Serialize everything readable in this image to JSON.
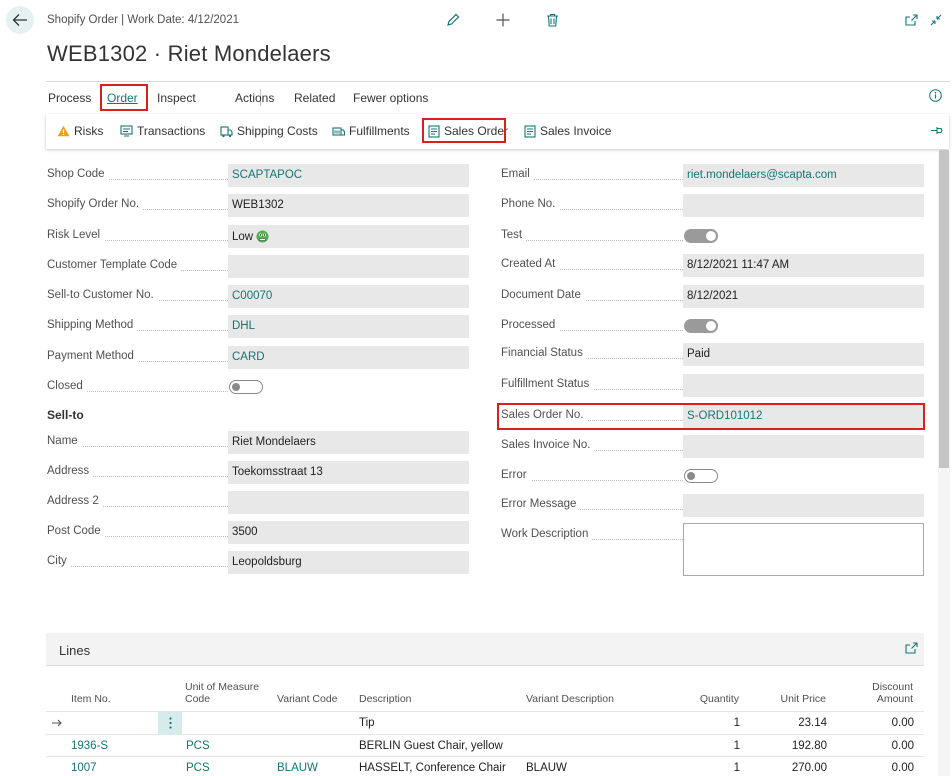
{
  "header": {
    "caption": "Shopify Order | Work Date: 4/12/2021",
    "title": "WEB1302 · Riet Mondelaers"
  },
  "menu": {
    "process": "Process",
    "order": "Order",
    "inspect": "Inspect",
    "actions": "Actions",
    "related": "Related",
    "fewer": "Fewer options"
  },
  "toolbar": {
    "risks": "Risks",
    "transactions": "Transactions",
    "shipping_costs": "Shipping Costs",
    "fulfillments": "Fulfillments",
    "sales_order": "Sales Order",
    "sales_invoice": "Sales Invoice"
  },
  "left": {
    "shop_code": {
      "label": "Shop Code",
      "value": "SCAPTAPOC"
    },
    "order_no": {
      "label": "Shopify Order No.",
      "value": "WEB1302"
    },
    "risk_level": {
      "label": "Risk Level",
      "value": "Low"
    },
    "customer_template": {
      "label": "Customer Template Code",
      "value": ""
    },
    "sell_to_customer": {
      "label": "Sell-to Customer No.",
      "value": "C00070"
    },
    "shipping_method": {
      "label": "Shipping Method",
      "value": "DHL"
    },
    "payment_method": {
      "label": "Payment Method",
      "value": "CARD"
    },
    "closed": {
      "label": "Closed",
      "value": false
    }
  },
  "sell_to": {
    "heading": "Sell-to",
    "name": {
      "label": "Name",
      "value": "Riet Mondelaers"
    },
    "address": {
      "label": "Address",
      "value": "Toekomsstraat 13"
    },
    "address2": {
      "label": "Address 2",
      "value": ""
    },
    "post_code": {
      "label": "Post Code",
      "value": "3500"
    },
    "city": {
      "label": "City",
      "value": "Leopoldsburg"
    }
  },
  "right": {
    "email": {
      "label": "Email",
      "value": "riet.mondelaers@scapta.com"
    },
    "phone": {
      "label": "Phone No.",
      "value": ""
    },
    "test": {
      "label": "Test",
      "value": true
    },
    "created_at": {
      "label": "Created At",
      "value": "8/12/2021 11:47 AM"
    },
    "document_date": {
      "label": "Document Date",
      "value": "8/12/2021"
    },
    "processed": {
      "label": "Processed",
      "value": true
    },
    "financial_status": {
      "label": "Financial Status",
      "value": "Paid"
    },
    "fulfillment_status": {
      "label": "Fulfillment Status",
      "value": ""
    },
    "sales_order_no": {
      "label": "Sales Order No.",
      "value": "S-ORD101012"
    },
    "sales_invoice_no": {
      "label": "Sales Invoice No.",
      "value": ""
    },
    "error": {
      "label": "Error",
      "value": false
    },
    "error_message": {
      "label": "Error Message",
      "value": ""
    },
    "work_description": {
      "label": "Work Description",
      "value": ""
    }
  },
  "lines": {
    "title": "Lines",
    "columns": {
      "item_no": "Item No.",
      "uom_1": "Unit of Measure",
      "uom_2": "Code",
      "variant_code": "Variant Code",
      "description": "Description",
      "variant_description": "Variant Description",
      "quantity": "Quantity",
      "unit_price": "Unit Price",
      "discount_1": "Discount",
      "discount_2": "Amount"
    },
    "rows": [
      {
        "item_no": "",
        "uom": "",
        "variant_code": "",
        "description": "Tip",
        "variant_description": "",
        "quantity": "1",
        "unit_price": "23.14",
        "discount": "0.00"
      },
      {
        "item_no": "1936-S",
        "uom": "PCS",
        "variant_code": "",
        "description": "BERLIN Guest Chair, yellow",
        "variant_description": "",
        "quantity": "1",
        "unit_price": "192.80",
        "discount": "0.00"
      },
      {
        "item_no": "1007",
        "uom": "PCS",
        "variant_code": "BLAUW",
        "description": "HASSELT, Conference Chair",
        "variant_description": "BLAUW",
        "quantity": "1",
        "unit_price": "270.00",
        "discount": "0.00"
      }
    ]
  },
  "colors": {
    "accent": "#147575",
    "highlight": "#d9201c",
    "field_bg": "#e8e8e8"
  },
  "icons": [
    "back-arrow-icon",
    "edit-pencil-icon",
    "add-plus-icon",
    "delete-trash-icon",
    "open-new-window-icon",
    "collapse-icon",
    "info-icon",
    "warning-icon",
    "pin-icon",
    "risk-emoji-icon",
    "expand-icon",
    "more-options-icon",
    "current-row-arrow-icon"
  ]
}
